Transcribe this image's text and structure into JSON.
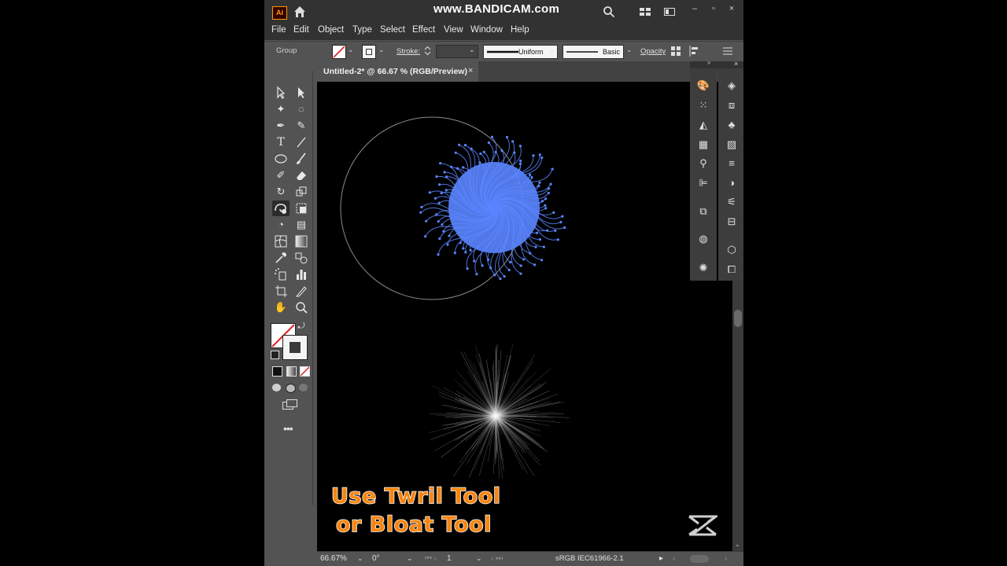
{
  "app": {
    "logo": "Ai",
    "watermark": "www.BANDICAM.com",
    "window_buttons": [
      "–",
      "▫",
      "×"
    ]
  },
  "menu": [
    "File",
    "Edit",
    "Object",
    "Type",
    "Select",
    "Effect",
    "View",
    "Window",
    "Help"
  ],
  "control_bar": {
    "selection": "Group",
    "stroke_label": "Stroke:",
    "uniform_label": "Uniform",
    "basic_label": "Basic",
    "opacity_label": "Opacity"
  },
  "document": {
    "tab_title": "Untitled-2* @ 66.67 % (RGB/Preview)",
    "close_glyph": "×"
  },
  "status": {
    "zoom": "66.67%",
    "rotation": "0°",
    "artboard": "1",
    "profile": "sRGB IEC61966-2.1"
  },
  "caption": {
    "line1": "Use Twril Tool",
    "line2": "or Bloat Tool"
  },
  "colors": {
    "accent_blue": "#5a85ff",
    "caption_orange": "#f7850f",
    "ui_dark": "#323232",
    "ui_mid": "#535353"
  }
}
